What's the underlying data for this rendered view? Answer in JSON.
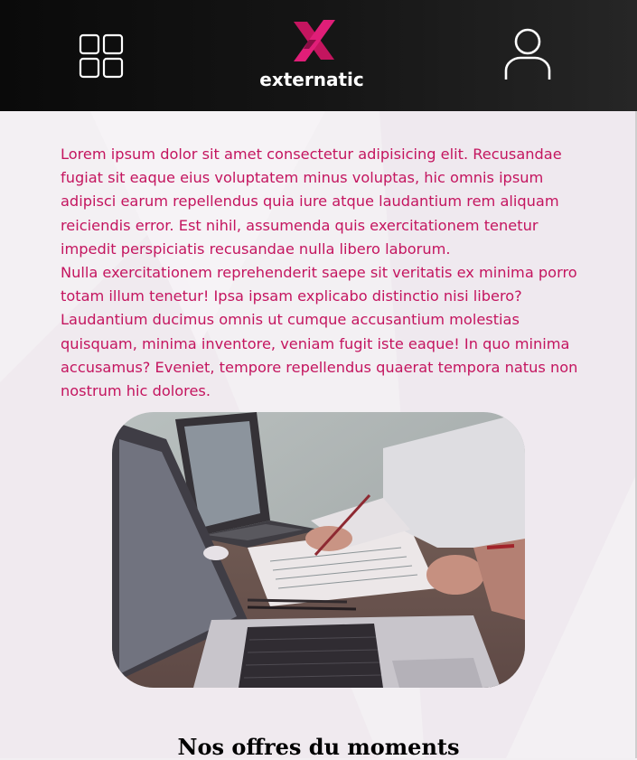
{
  "header": {
    "menu_icon": "grid-icon",
    "brand": "externatic",
    "profile_icon": "user-icon",
    "accent": "#c4155f"
  },
  "intro": {
    "paragraph_1": "Lorem ipsum dolor sit amet consectetur adipisicing elit. Recusandae fugiat sit eaque eius voluptatem minus voluptas, hic omnis ipsum adipisci earum repellendus quia iure atque laudantium rem aliquam reiciendis error. Est nihil, assumenda quis exercitationem tenetur impedit perspiciatis recusandae nulla libero laborum.",
    "paragraph_2": "Nulla exercitationem reprehenderit saepe sit veritatis ex minima porro totam illum tenetur! Ipsa ipsam explicabo distinctio nisi libero? Laudantium ducimus omnis ut cumque accusantium molestias quisquam, minima inventore, veniam fugit iste eaque! In quo minima accusamus? Eveniet, tempore repellendus quaerat tempora natus non nostrum hic dolores."
  },
  "image": {
    "subject": "office-meeting-photo"
  },
  "offers": {
    "title": "Nos offres du moments"
  }
}
